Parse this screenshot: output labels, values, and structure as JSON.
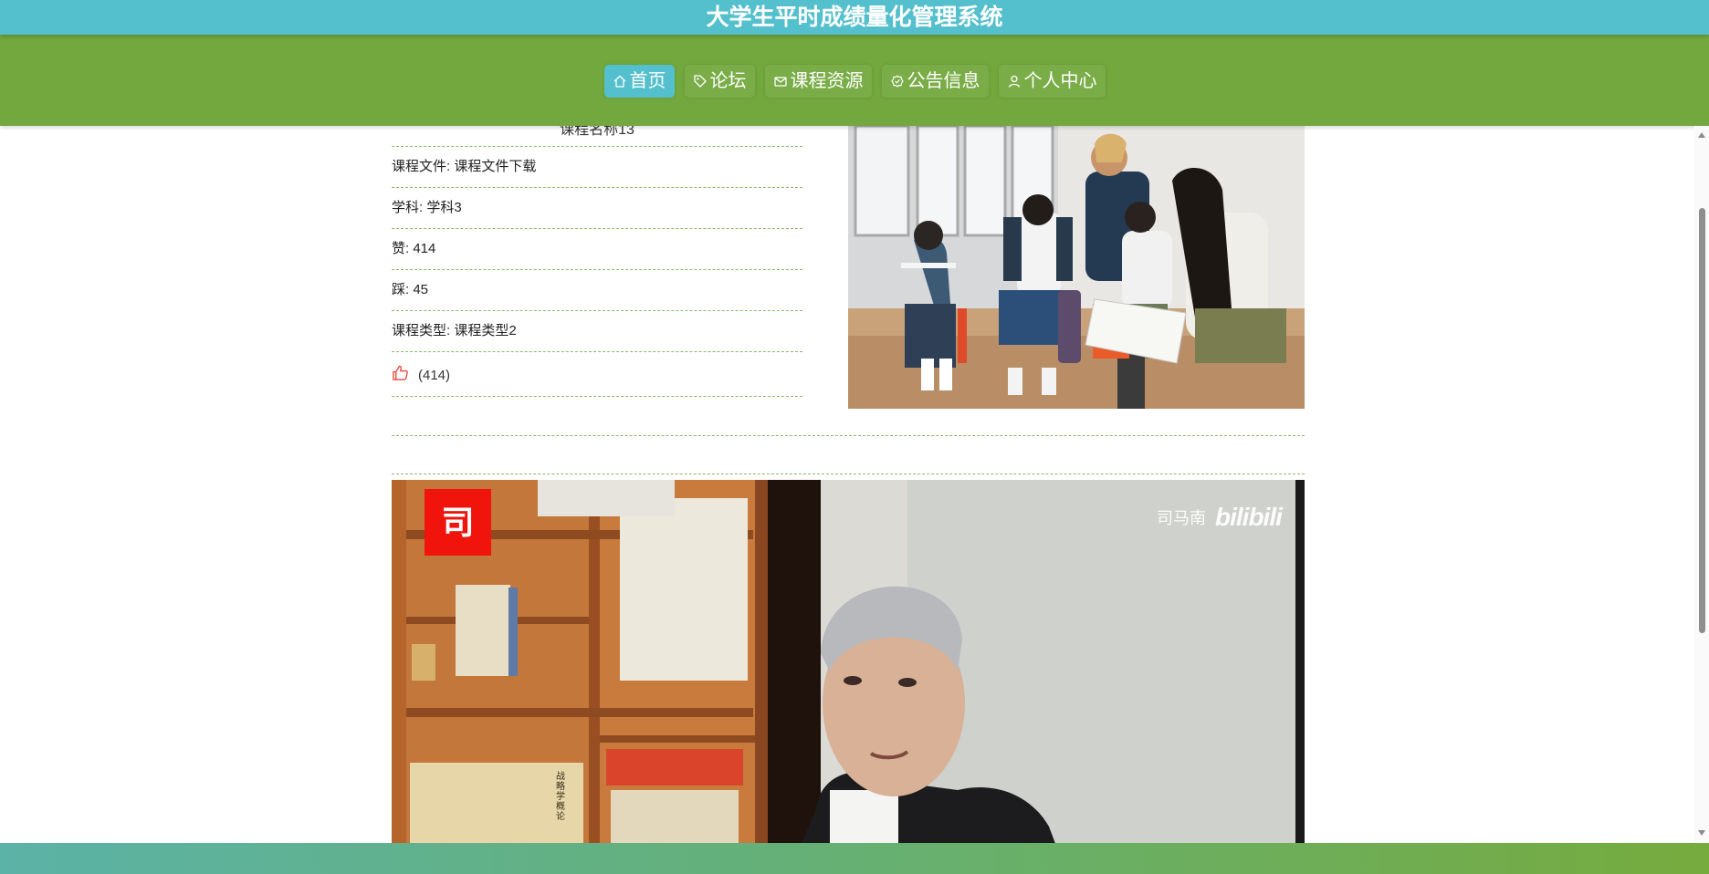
{
  "app": {
    "title": "大学生平时成绩量化管理系统"
  },
  "nav": {
    "items": [
      {
        "label": "首页",
        "icon": "home-icon"
      },
      {
        "label": "论坛",
        "icon": "tag-icon"
      },
      {
        "label": "课程资源",
        "icon": "mail-icon"
      },
      {
        "label": "公告信息",
        "icon": "badge-icon"
      },
      {
        "label": "个人中心",
        "icon": "user-icon"
      }
    ],
    "active_index": 0
  },
  "course": {
    "name": "课程名称13",
    "fields": [
      {
        "text": "课程文件: 课程文件下载"
      },
      {
        "text": "学科: 学科3"
      },
      {
        "text": "赞: 414"
      },
      {
        "text": "踩: 45"
      },
      {
        "text": "课程类型: 课程类型2"
      }
    ],
    "like_count": "(414)"
  },
  "video": {
    "channel_badge": "司",
    "watermark_author": "司马南",
    "watermark_site": "bilibili",
    "book_spine_text": "战略学概论"
  },
  "colors": {
    "titlebar": "#55c0cd",
    "navbar": "#72a83d",
    "active_nav": "#55c0cd",
    "divider": "#8ab86a",
    "like_icon": "#e8473b"
  }
}
